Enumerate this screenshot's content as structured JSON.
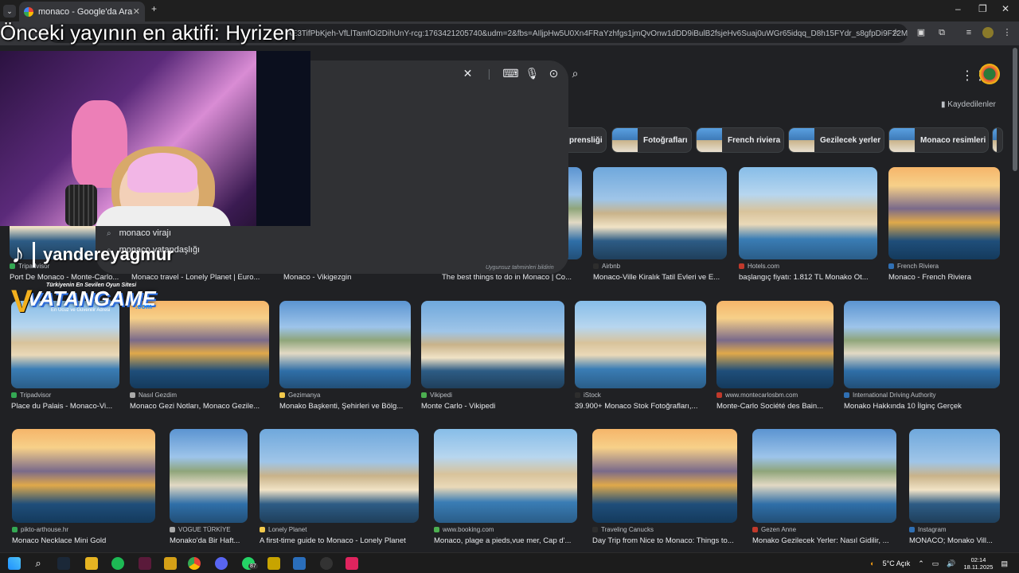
{
  "browser": {
    "tab_title": "monaco - Google'da Ara",
    "url": "AE3TifPbKjeh-VfLlTamfOi2DihUnY-rcg:1763421205740&udm=2&fbs=AIljpHw5U0Xn4FRaYzhfgs1jmQvOnw1dDD9iBulB2fsjeHv6Suaj0uWGr65idqq_D8h15FYdr_s8gfpDi9F22MheIAW..."
  },
  "overlay": {
    "title": "Önceki yayının en aktifi: Hyrizen",
    "tiktok_handle": "yandereyagmur",
    "vatan_sub": "Türkiyenin En Sevilen Oyun Sitesi",
    "vatan_brand": "VATANGAME",
    "vatan_tag": "En Ucuz ve Güvenilir Adresi",
    "vatan_com": ".com"
  },
  "search": {
    "suggestions": [
      "monaco virajı",
      "monaco vatandaşlığı"
    ],
    "unsuitable": "Uygunsuz tahminleri bildirin",
    "saved": "Kaydedilenler"
  },
  "chips": [
    "prensliği",
    "Fotoğrafları",
    "French riviera",
    "Gezilecek yerler",
    "Monaco resimleri"
  ],
  "row1": [
    {
      "source": "Tripadvisor",
      "title": "Port De Monaco - Monte-Carlo..."
    },
    {
      "source": "",
      "title": "Monaco travel - Lonely Planet | Euro..."
    },
    {
      "source": "",
      "title": "Monaco - Vikigezgin"
    },
    {
      "source": "",
      "title": "The best things to do in Monaco | Co..."
    },
    {
      "source": "Airbnb",
      "title": "Monaco-Ville Kiralık Tatil Evleri ve E..."
    },
    {
      "source": "Hotels.com",
      "title": "başlangıç fiyatı: 1.812 TL Monako Ot..."
    },
    {
      "source": "French Riviera",
      "title": "Monaco - French Riviera"
    }
  ],
  "row2": [
    {
      "source": "Tripadvisor",
      "title": "Place du Palais - Monaco-Vi..."
    },
    {
      "source": "Nasıl Gezdim",
      "title": "Monaco Gezi Notları, Monaco Gezile..."
    },
    {
      "source": "Gezimanya",
      "title": "Monako Başkenti, Şehirleri ve Bölg..."
    },
    {
      "source": "Vikipedi",
      "title": "Monte Carlo - Vikipedi"
    },
    {
      "source": "iStock",
      "title": "39.900+ Monaco Stok Fotoğrafları,..."
    },
    {
      "source": "www.montecarlosbm.com",
      "title": "Monte-Carlo Société des Bain..."
    },
    {
      "source": "International Driving Authority",
      "title": "Monako Hakkında 10 İlginç Gerçek"
    }
  ],
  "row3": [
    {
      "source": "pikto-arthouse.hr",
      "title": "Monaco Necklace Mini Gold"
    },
    {
      "source": "VOGUE TÜRKİYE",
      "title": "Monako'da Bir Haft..."
    },
    {
      "source": "Lonely Planet",
      "title": "A first-time guide to Monaco - Lonely Planet"
    },
    {
      "source": "www.booking.com",
      "title": "Monaco, plage a pieds,vue mer, Cap d'..."
    },
    {
      "source": "Traveling Canucks",
      "title": "Day Trip from Nice to Monaco: Things to..."
    },
    {
      "source": "Gezen Anne",
      "title": "Monako Gezilecek Yerler: Nasıl Gidilir, ..."
    },
    {
      "source": "Instagram",
      "title": "MONACO; Monako Vill..."
    }
  ],
  "taskbar": {
    "weather": "5°C  Açık",
    "time": "02:14",
    "date": "18.11.2025",
    "badge": "87"
  }
}
